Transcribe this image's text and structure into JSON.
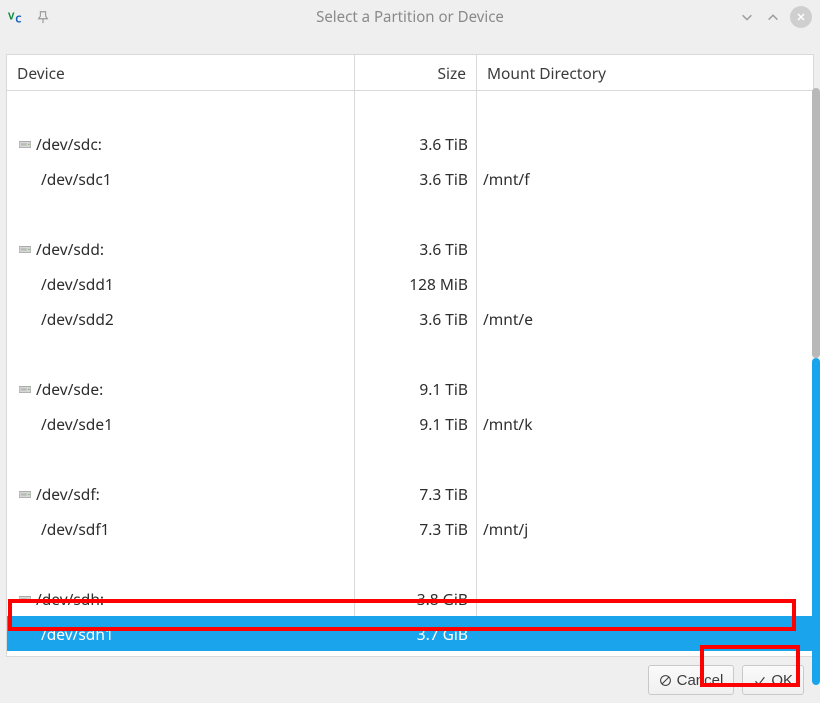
{
  "window": {
    "title": "Select a Partition or Device"
  },
  "columns": {
    "device": "Device",
    "size": "Size",
    "mount": "Mount Directory"
  },
  "rows": [
    {
      "type": "blank"
    },
    {
      "type": "disk",
      "device": "/dev/sdc:",
      "size": "3.6 TiB",
      "mount": ""
    },
    {
      "type": "part",
      "device": "/dev/sdc1",
      "size": "3.6 TiB",
      "mount": "/mnt/f"
    },
    {
      "type": "blank"
    },
    {
      "type": "disk",
      "device": "/dev/sdd:",
      "size": "3.6 TiB",
      "mount": ""
    },
    {
      "type": "part",
      "device": "/dev/sdd1",
      "size": "128 MiB",
      "mount": ""
    },
    {
      "type": "part",
      "device": "/dev/sdd2",
      "size": "3.6 TiB",
      "mount": "/mnt/e"
    },
    {
      "type": "blank"
    },
    {
      "type": "disk",
      "device": "/dev/sde:",
      "size": "9.1 TiB",
      "mount": ""
    },
    {
      "type": "part",
      "device": "/dev/sde1",
      "size": "9.1 TiB",
      "mount": "/mnt/k"
    },
    {
      "type": "blank"
    },
    {
      "type": "disk",
      "device": "/dev/sdf:",
      "size": "7.3 TiB",
      "mount": ""
    },
    {
      "type": "part",
      "device": "/dev/sdf1",
      "size": "7.3 TiB",
      "mount": "/mnt/j"
    },
    {
      "type": "blank"
    },
    {
      "type": "disk",
      "device": "/dev/sdh:",
      "size": "3.8 GiB",
      "mount": ""
    },
    {
      "type": "part",
      "device": "/dev/sdh1",
      "size": "3.7 GiB",
      "mount": "",
      "selected": true
    }
  ],
  "buttons": {
    "cancel": "Cancel",
    "ok": "OK"
  }
}
